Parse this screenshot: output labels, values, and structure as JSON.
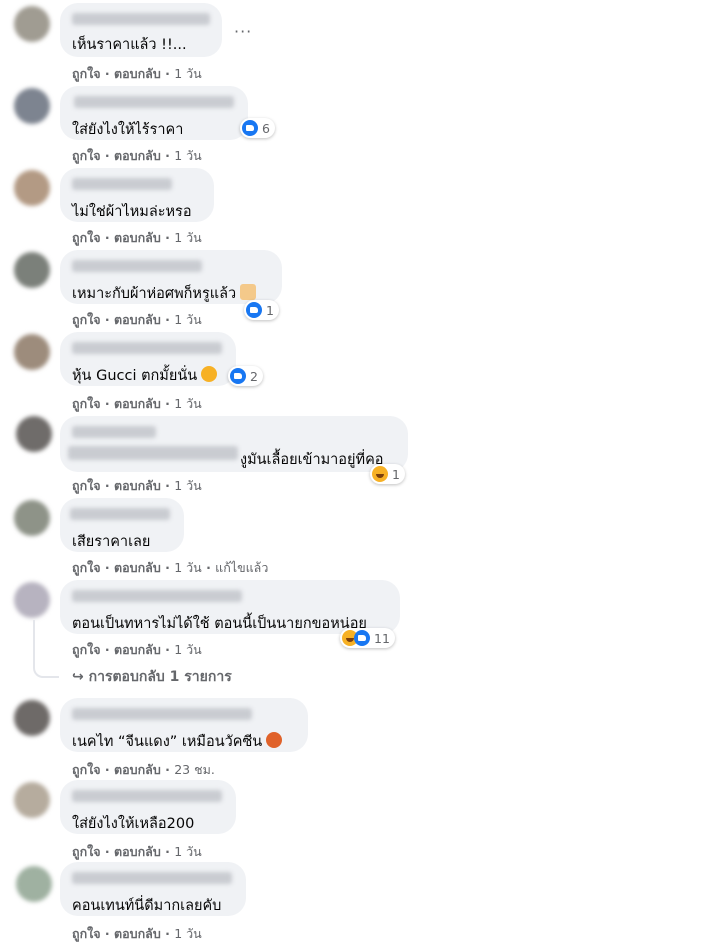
{
  "actions": {
    "like": "ถูกใจ",
    "reply": "ตอบกลับ",
    "separator": " · "
  },
  "comments": [
    {
      "text": "เห็นราคาแล้ว !!...",
      "time": "1 วัน",
      "more": "···"
    },
    {
      "text": "ใส่ยังไงให้ไร้ราคา",
      "time": "1 วัน",
      "reaction_count": "6",
      "reaction": "like"
    },
    {
      "text": "ไม่ใช่ผ้าไหมล่ะหรอ",
      "time": "1 วัน"
    },
    {
      "text": "เหมาะกับผ้าห่อศพก็หรูแล้ว",
      "time": "1 วัน",
      "reaction_count": "1",
      "reaction": "like",
      "emoji": "thumbs-down-emoji"
    },
    {
      "text": "หุ้น Gucci ตกมั้ยนั่น",
      "time": "1 วัน",
      "reaction_count": "2",
      "reaction": "like",
      "emoji": "rofl-emoji"
    },
    {
      "text": "งูมันเลื้อยเข้ามาอยู่ที่คอ",
      "time": "1 วัน",
      "reaction_count": "1",
      "reaction": "haha"
    },
    {
      "text": "เสียราคาเลย",
      "time": "1 วัน",
      "edited": "แก้ไขแล้ว"
    },
    {
      "text": "ตอนเป็นทหารไม่ได้ใช้ ตอนนี้เป็นนายกขอหน่อย",
      "time": "1 วัน",
      "reaction_count": "11",
      "reaction": "haha-like"
    },
    {
      "text": "เนคไท “จีนแดง” เหมือนวัคซีน",
      "time": "23 ชม.",
      "emoji": "angry-emoji"
    },
    {
      "text": "ใส่ยังไงให้เหลือ200",
      "time": "1 วัน"
    },
    {
      "text": "คอนเทนท์นี่ดีมากเลยคับ",
      "time": "1 วัน"
    }
  ],
  "replies_link": {
    "icon": "reply-arrow-icon",
    "label": "การตอบกลับ 1 รายการ"
  },
  "colors": {
    "bubble": "#f0f2f5",
    "meta": "#65676b",
    "like": "#1877f2",
    "haha": "#f7b125"
  }
}
